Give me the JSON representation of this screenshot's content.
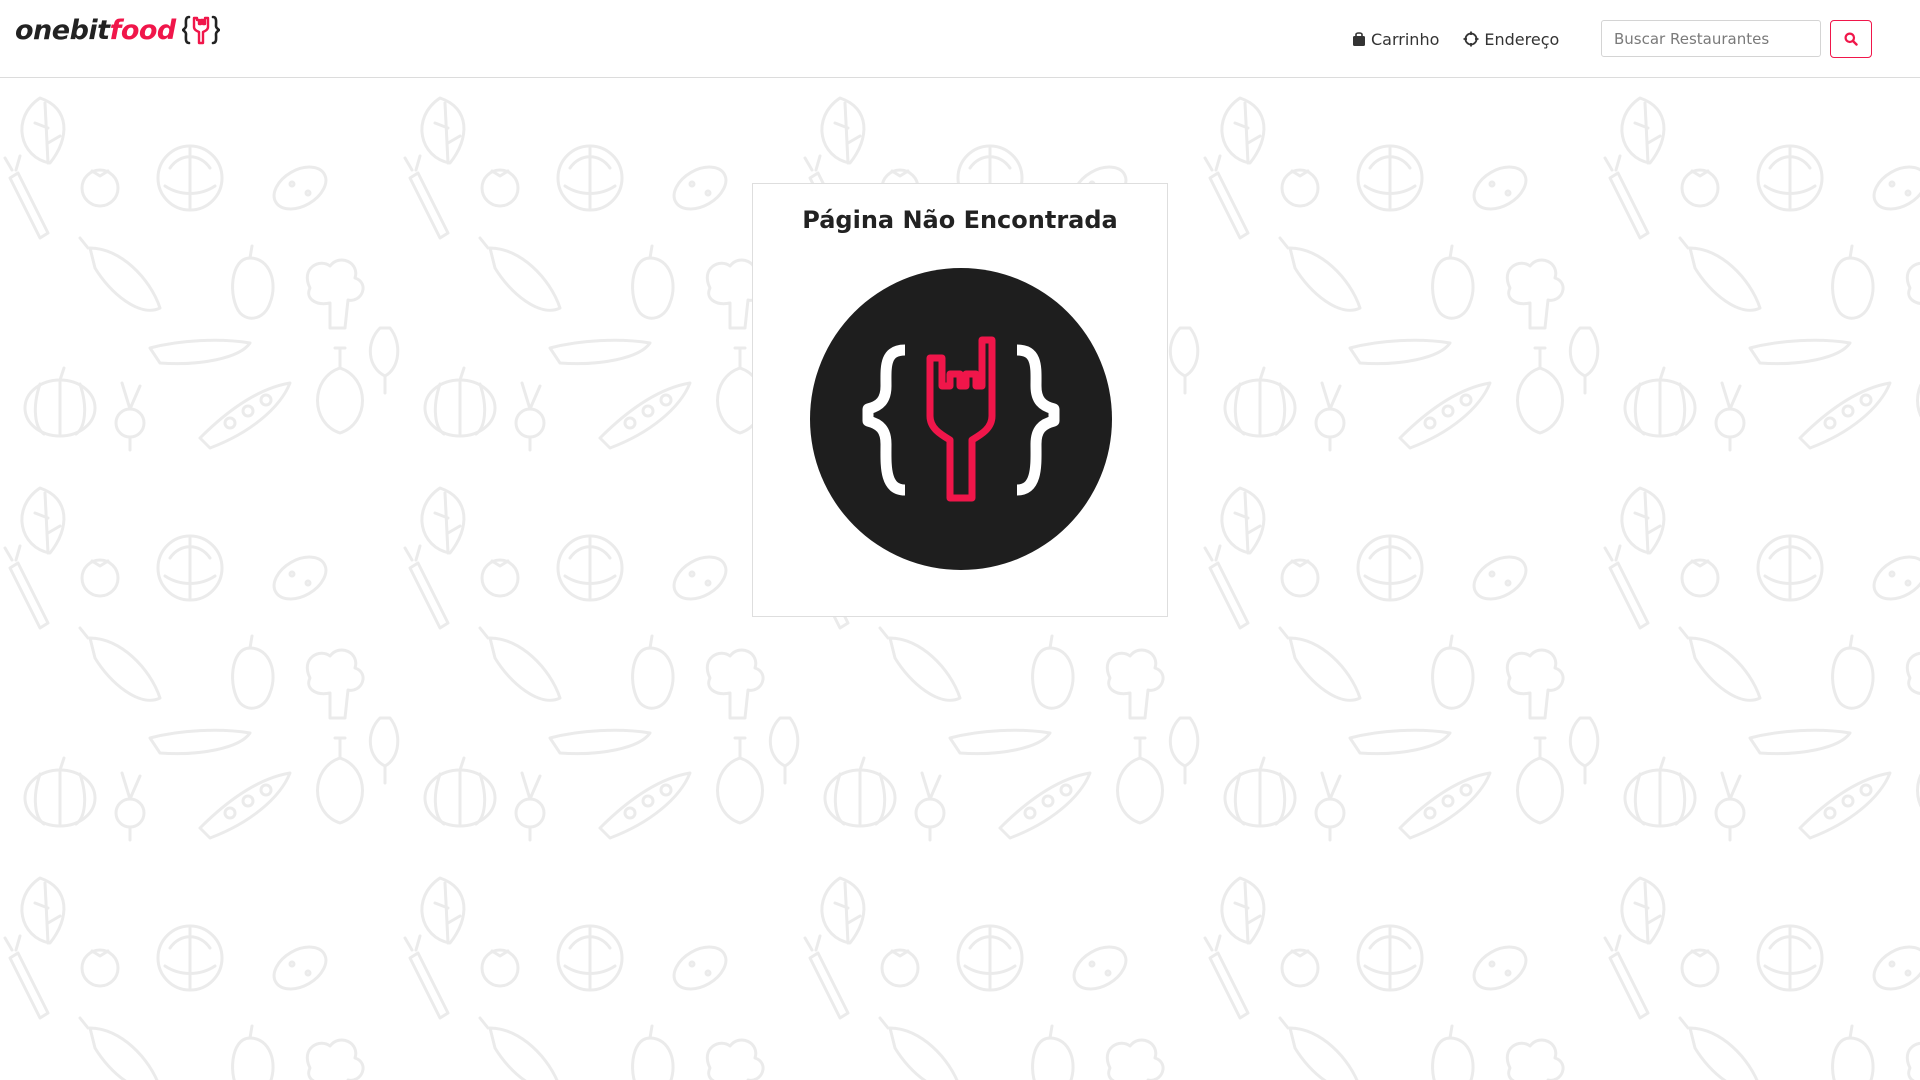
{
  "header": {
    "logo": {
      "text_onebit": "onebit",
      "text_food": "food",
      "icon": "fork-braces-icon"
    },
    "nav": [
      {
        "label": "Carrinho",
        "icon": "shopping-bag-icon"
      },
      {
        "label": "Endereço",
        "icon": "crosshair-icon"
      }
    ],
    "search": {
      "placeholder": "Buscar Restaurantes",
      "value": "",
      "button_icon": "search-icon"
    }
  },
  "main": {
    "title": "Página Não Encontrada",
    "image_icon": "onebitfood-logo-icon"
  },
  "colors": {
    "brand": "#f0164a",
    "dark": "#222222",
    "circle": "#1e1e1e",
    "pattern": "#ececec"
  }
}
